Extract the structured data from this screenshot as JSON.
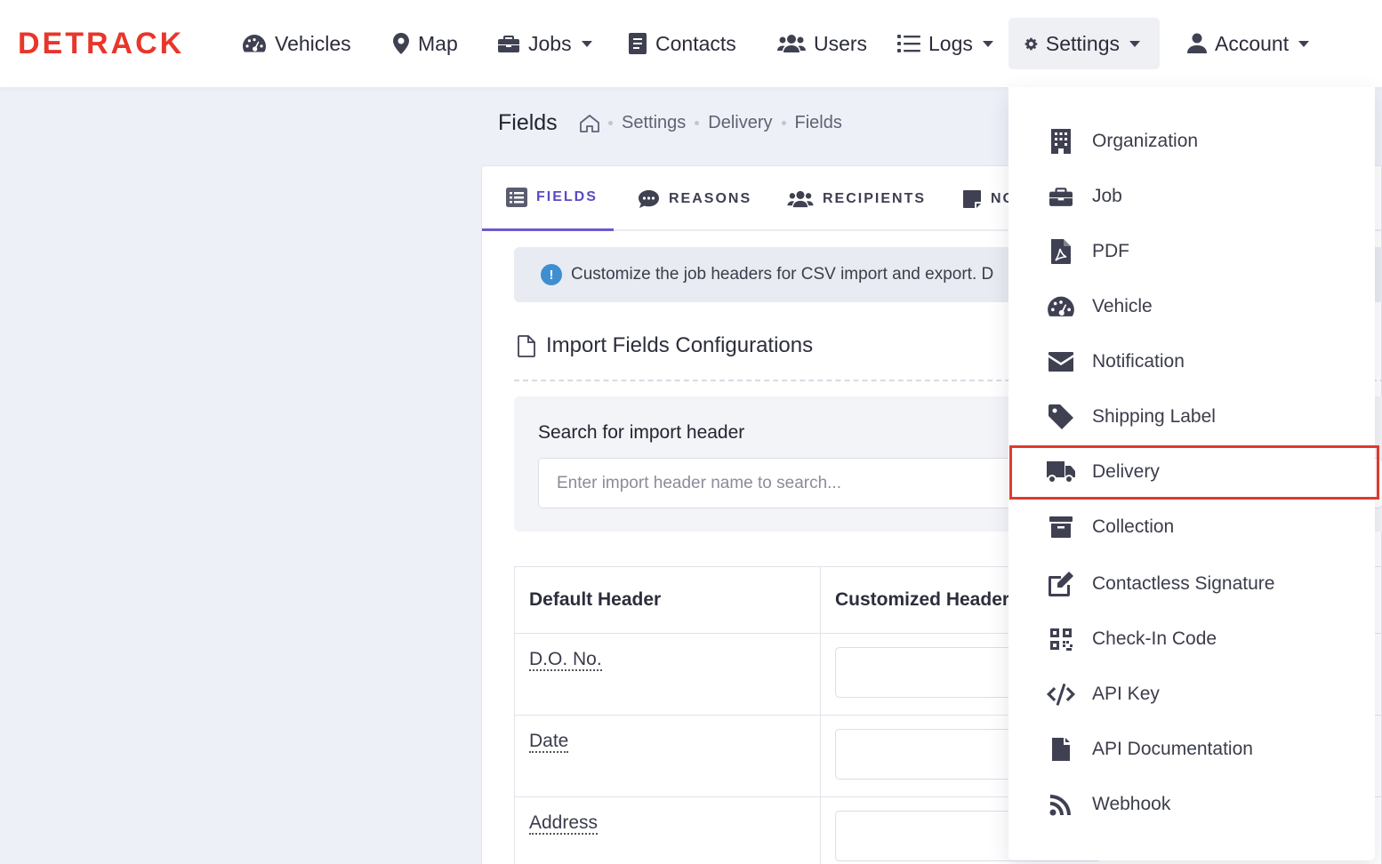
{
  "brand": {
    "logo_text": "DETRACK",
    "accent": "#e8362b"
  },
  "nav": {
    "vehicles": "Vehicles",
    "map": "Map",
    "jobs": "Jobs",
    "contacts": "Contacts",
    "users": "Users",
    "logs": "Logs",
    "settings": "Settings",
    "account": "Account"
  },
  "page": {
    "title": "Fields",
    "breadcrumb": [
      "Settings",
      "Delivery",
      "Fields"
    ]
  },
  "tabs": [
    "FIELDS",
    "REASONS",
    "RECIPIENTS",
    "NO"
  ],
  "alert": {
    "text": "Customize the job headers for CSV import and export. D"
  },
  "section": {
    "title": "Import Fields Configurations"
  },
  "search": {
    "label": "Search for import header",
    "placeholder": "Enter import header name to search..."
  },
  "table": {
    "headers": [
      "Default Header",
      "Customized Header"
    ],
    "rows": [
      "D.O. No.",
      "Date",
      "Address"
    ]
  },
  "settings_menu": [
    {
      "label": "Organization",
      "icon": "building-icon"
    },
    {
      "label": "Job",
      "icon": "briefcase-icon"
    },
    {
      "label": "PDF",
      "icon": "pdf-file-icon"
    },
    {
      "label": "Vehicle",
      "icon": "gauge-icon"
    },
    {
      "label": "Notification",
      "icon": "envelope-icon"
    },
    {
      "label": "Shipping Label",
      "icon": "tag-icon"
    },
    {
      "label": "Delivery",
      "icon": "truck-icon"
    },
    {
      "label": "Collection",
      "icon": "archive-icon"
    },
    {
      "label": "Contactless Signature",
      "icon": "edit-icon"
    },
    {
      "label": "Check-In Code",
      "icon": "qrcode-icon"
    },
    {
      "label": "API Key",
      "icon": "code-icon"
    },
    {
      "label": "API Documentation",
      "icon": "file-icon"
    },
    {
      "label": "Webhook",
      "icon": "rss-icon"
    }
  ],
  "highlight_color": "#e03a2e"
}
